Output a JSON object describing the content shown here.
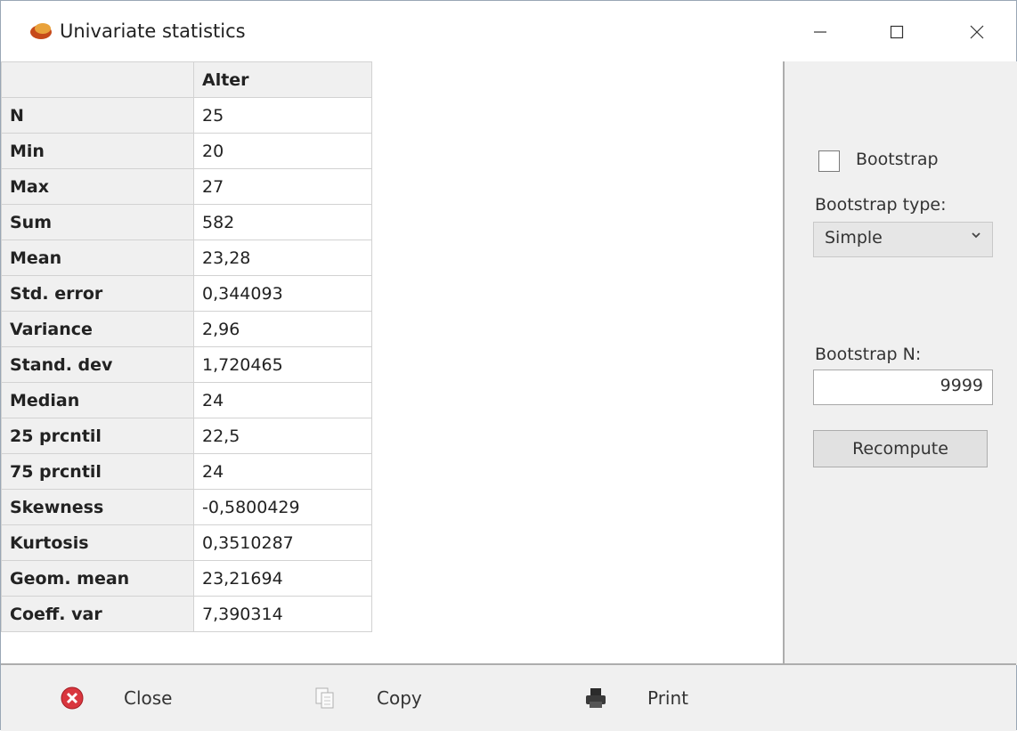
{
  "window": {
    "title": "Univariate statistics"
  },
  "table": {
    "column_header": "Alter",
    "rows": [
      {
        "label": "N",
        "value": "25"
      },
      {
        "label": "Min",
        "value": "20"
      },
      {
        "label": "Max",
        "value": "27"
      },
      {
        "label": "Sum",
        "value": "582"
      },
      {
        "label": "Mean",
        "value": "23,28"
      },
      {
        "label": "Std. error",
        "value": "0,344093"
      },
      {
        "label": "Variance",
        "value": "2,96"
      },
      {
        "label": "Stand. dev",
        "value": "1,720465"
      },
      {
        "label": "Median",
        "value": "24"
      },
      {
        "label": "25 prcntil",
        "value": "22,5"
      },
      {
        "label": "75 prcntil",
        "value": "24"
      },
      {
        "label": "Skewness",
        "value": "-0,5800429"
      },
      {
        "label": "Kurtosis",
        "value": "0,3510287"
      },
      {
        "label": "Geom. mean",
        "value": "23,21694"
      },
      {
        "label": "Coeff. var",
        "value": "7,390314"
      }
    ]
  },
  "panel": {
    "bootstrap_label": "Bootstrap",
    "bootstrap_checked": false,
    "type_label": "Bootstrap type:",
    "type_value": "Simple",
    "n_label": "Bootstrap N:",
    "n_value": "9999",
    "recompute_label": "Recompute"
  },
  "toolbar": {
    "close_label": "Close",
    "copy_label": "Copy",
    "print_label": "Print"
  },
  "icons": {
    "app": "app-logo-icon",
    "close": "close-circle-icon",
    "copy": "copy-icon",
    "print": "printer-icon"
  },
  "colors": {
    "close_icon": "#d9363e",
    "panel_bg": "#f0f0f0"
  }
}
